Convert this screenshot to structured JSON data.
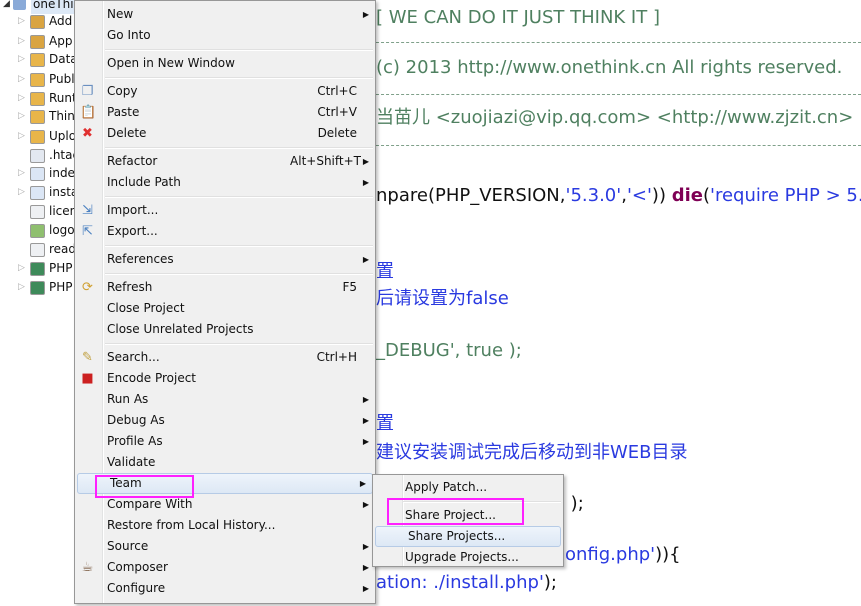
{
  "tree": {
    "root": "oneThink",
    "items": [
      "Addons",
      "Application",
      "Data",
      "Public",
      "Runtime",
      "ThinkPHP",
      "Uploads",
      ".htaccess",
      "index.php",
      "install.php",
      "license.txt",
      "logo.png",
      "readme.txt",
      "PHP Language Library",
      "PHP Include Path"
    ],
    "visible_labels": [
      "Add",
      "App",
      "Data",
      "Publ",
      "Runt",
      "Thin",
      "Uplo",
      ".htac",
      "inde",
      "insta",
      "licen",
      "logo",
      "read",
      "PHP",
      "PHP"
    ]
  },
  "code": {
    "lines": [
      {
        "parts": [
          {
            "t": "[ WE CAN DO IT JUST THINK IT ]",
            "c": "cmt"
          }
        ]
      },
      {
        "parts": [
          {
            "t": "(c) 2013 http://www.onethink.cn All rights reserved.",
            "c": "cmt"
          }
        ]
      },
      {
        "parts": [
          {
            "t": "当苗儿 <zuojiazi@vip.qq.com> <http://www.zjzit.cn>",
            "c": "cmt"
          }
        ]
      },
      {
        "parts": [
          {
            "t": "npare(PHP_VERSION,",
            "c": "blk"
          },
          {
            "t": "'5.3.0'",
            "c": "str"
          },
          {
            "t": ",",
            "c": "blk"
          },
          {
            "t": "'<'",
            "c": "str"
          },
          {
            "t": "))  ",
            "c": "blk"
          },
          {
            "t": "die",
            "c": "kw"
          },
          {
            "t": "(",
            "c": "blk"
          },
          {
            "t": "'require PHP > 5.",
            "c": "str"
          }
        ]
      },
      {
        "parts": [
          {
            "t": "置",
            "c": "str"
          }
        ]
      },
      {
        "parts": [
          {
            "t": "后请设置为false",
            "c": "str"
          }
        ]
      },
      {
        "parts": [
          {
            "t": "_DEBUG', true );",
            "c": "cmt"
          }
        ]
      },
      {
        "parts": [
          {
            "t": "置",
            "c": "str"
          }
        ]
      },
      {
        "parts": [
          {
            "t": "建议安装调试完成后移动到非WEB目录",
            "c": "str"
          }
        ]
      },
      {
        "parts": [
          {
            "t": "' );",
            "c": "blk"
          }
        ]
      },
      {
        "parts": [
          {
            "t": "onfig.php'",
            "c": "str"
          },
          {
            "t": ")){",
            "c": "blk"
          }
        ]
      },
      {
        "parts": [
          {
            "t": "ation: ./install.php'",
            "c": "str"
          },
          {
            "t": ");",
            "c": "blk"
          }
        ]
      }
    ]
  },
  "context_menu": {
    "groups": [
      [
        {
          "label": "New",
          "submenu": true
        },
        {
          "label": "Go Into"
        }
      ],
      [
        {
          "label": "Open in New Window"
        }
      ],
      [
        {
          "label": "Copy",
          "shortcut": "Ctrl+C",
          "icon": "copy-icon"
        },
        {
          "label": "Paste",
          "shortcut": "Ctrl+V",
          "icon": "paste-icon"
        },
        {
          "label": "Delete",
          "shortcut": "Delete",
          "icon": "delete-icon"
        }
      ],
      [
        {
          "label": "Refactor",
          "shortcut": "Alt+Shift+T",
          "submenu": true
        },
        {
          "label": "Include Path",
          "submenu": true
        }
      ],
      [
        {
          "label": "Import...",
          "icon": "import-icon"
        },
        {
          "label": "Export...",
          "icon": "export-icon"
        }
      ],
      [
        {
          "label": "References",
          "submenu": true
        }
      ],
      [
        {
          "label": "Refresh",
          "shortcut": "F5",
          "icon": "refresh-icon"
        },
        {
          "label": "Close Project"
        },
        {
          "label": "Close Unrelated Projects"
        }
      ],
      [
        {
          "label": "Search...",
          "shortcut": "Ctrl+H",
          "icon": "search-icon"
        },
        {
          "label": "Encode Project",
          "icon": "encode-icon"
        },
        {
          "label": "Run As",
          "submenu": true
        },
        {
          "label": "Debug As",
          "submenu": true
        },
        {
          "label": "Profile As",
          "submenu": true
        },
        {
          "label": "Validate"
        },
        {
          "label": "Team",
          "submenu": true,
          "highlighted": true
        },
        {
          "label": "Compare With",
          "submenu": true
        },
        {
          "label": "Restore from Local History..."
        },
        {
          "label": "Source",
          "submenu": true
        },
        {
          "label": "Composer",
          "submenu": true,
          "icon": "composer-icon"
        },
        {
          "label": "Configure",
          "submenu": true
        }
      ]
    ]
  },
  "team_submenu": {
    "groups": [
      [
        {
          "label": "Apply Patch..."
        }
      ],
      [
        {
          "label": "Share Project..."
        },
        {
          "label": "Share Projects...",
          "highlighted": true
        },
        {
          "label": "Upgrade Projects..."
        }
      ]
    ]
  },
  "annotation_color": "#ff20ff"
}
